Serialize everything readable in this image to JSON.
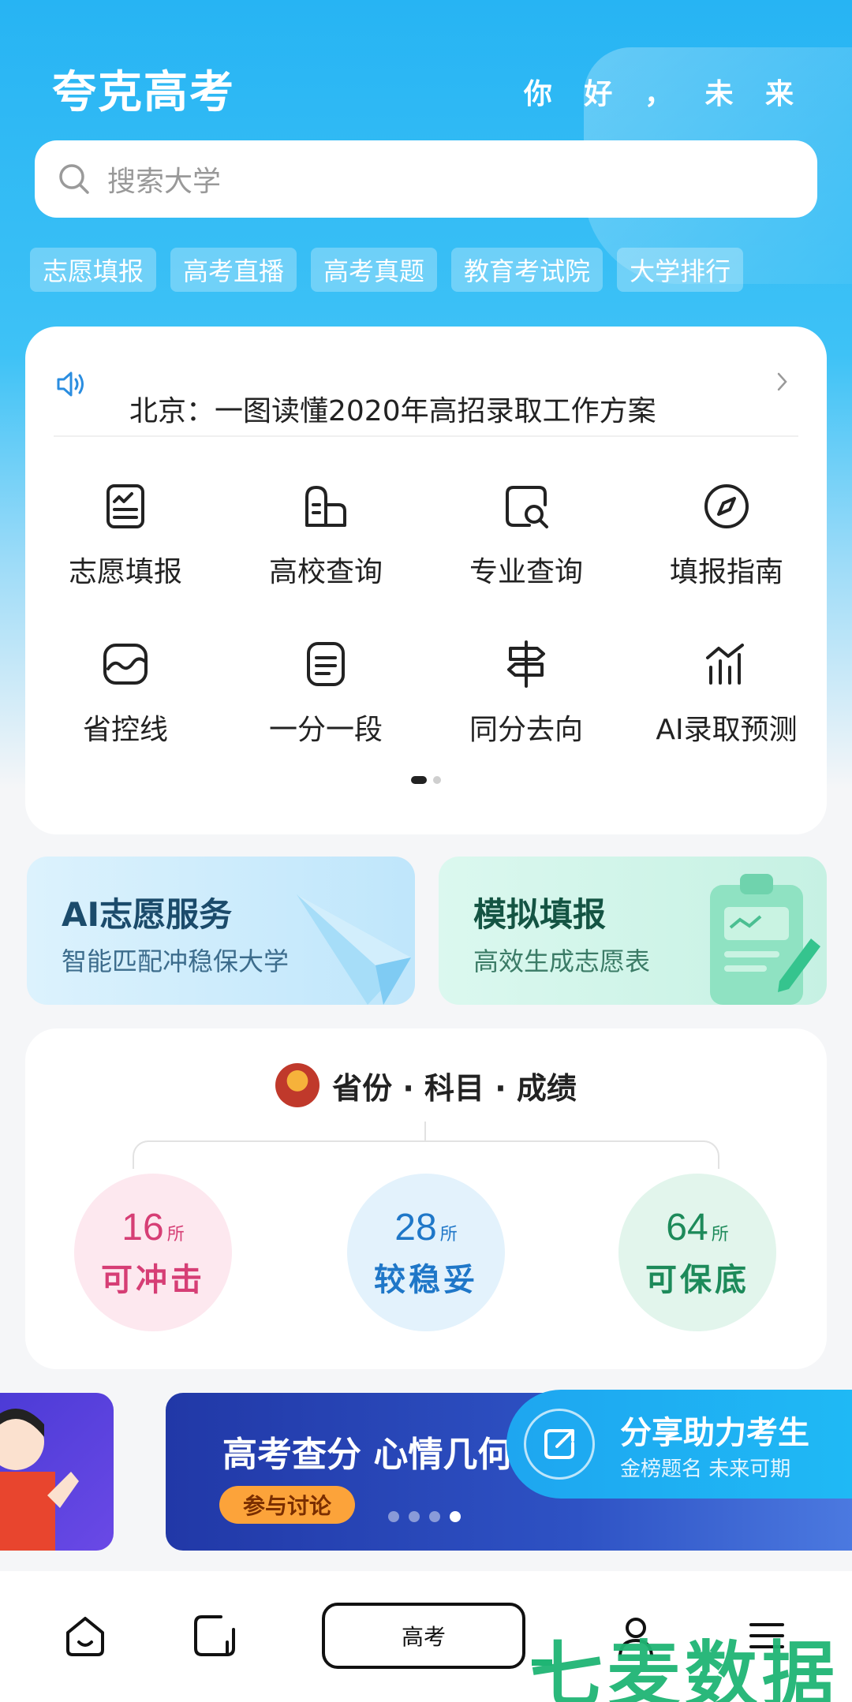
{
  "header": {
    "app_title": "夸克高考",
    "slogan": "你 好 ， 未 来"
  },
  "search": {
    "placeholder": "搜索大学",
    "icon": "search-icon"
  },
  "quick_tags": [
    "志愿填报",
    "高考直播",
    "高考真题",
    "教育考试院",
    "大学排行"
  ],
  "notice": {
    "text": "北京：一图读懂2020年高招录取工作方案",
    "icon": "speaker-icon"
  },
  "features": [
    {
      "label": "志愿填报",
      "icon": "form-icon"
    },
    {
      "label": "高校查询",
      "icon": "building-icon"
    },
    {
      "label": "专业查询",
      "icon": "doc-search-icon"
    },
    {
      "label": "填报指南",
      "icon": "compass-icon"
    },
    {
      "label": "省控线",
      "icon": "chart-wave-icon"
    },
    {
      "label": "一分一段",
      "icon": "list-doc-icon"
    },
    {
      "label": "同分去向",
      "icon": "signpost-icon"
    },
    {
      "label": "AI录取预测",
      "icon": "bar-trend-icon"
    }
  ],
  "pager": {
    "pages": 2,
    "active": 1
  },
  "promos": {
    "left": {
      "title": "AI志愿服务",
      "subtitle": "智能匹配冲稳保大学"
    },
    "right": {
      "title": "模拟填报",
      "subtitle": "高效生成志愿表"
    }
  },
  "score": {
    "title": "省份 · 科目 · 成绩",
    "unit": "所",
    "levels": [
      {
        "count": "16",
        "label": "可冲击",
        "color": "#d63e75"
      },
      {
        "count": "28",
        "label": "较稳妥",
        "color": "#1f77c8"
      },
      {
        "count": "64",
        "label": "可保底",
        "color": "#1d8a5a"
      }
    ]
  },
  "banner": {
    "title": "高考查分 心情几何",
    "button": "参与讨论",
    "dots": 4,
    "active_dot": 4
  },
  "share": {
    "title": "分享助力考生",
    "subtitle": "金榜题名 未来可期"
  },
  "tabbar": {
    "center_label": "高考"
  },
  "watermark": "七麦数据"
}
